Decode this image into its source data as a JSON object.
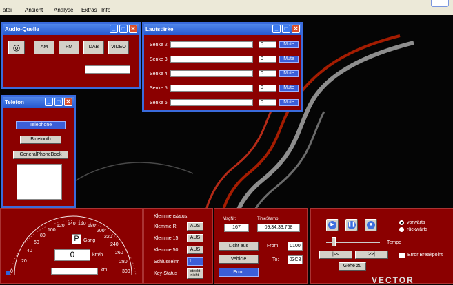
{
  "menu": [
    "atei",
    "Ansicht",
    "Analyse",
    "Extras",
    "Info"
  ],
  "audio_source": {
    "title": "Audio-Quelle",
    "sources": [
      "",
      "AM",
      "FM",
      "DAB",
      "VIDEO"
    ]
  },
  "volume": {
    "title": "Lautstärke",
    "rows": [
      {
        "label": "Senke 2",
        "value": "0",
        "mute": "Mute"
      },
      {
        "label": "Senke 3",
        "value": "0",
        "mute": "Mute"
      },
      {
        "label": "Senke 4",
        "value": "0",
        "mute": "Mute"
      },
      {
        "label": "Senke 5",
        "value": "0",
        "mute": "Mute"
      },
      {
        "label": "Senke 6",
        "value": "0",
        "mute": "Mute"
      }
    ]
  },
  "phone": {
    "title": "Telefon",
    "telephone_btn": "Telephone",
    "bluetooth_btn": "Bluetooth",
    "phonebook_btn": "GeneralPhoneBook"
  },
  "speedometer": {
    "ticks": [
      "20",
      "40",
      "60",
      "80",
      "100",
      "120",
      "140",
      "160",
      "180",
      "200",
      "220",
      "240",
      "260",
      "280",
      "300"
    ],
    "zero": "0",
    "gear": "P",
    "gear_label": "Gang",
    "speed": "0",
    "speed_unit": "km/h",
    "km_unit": "km"
  },
  "klemmen": {
    "title": "Klemmenstatus:",
    "rows": [
      {
        "label": "Klemme R",
        "value": "AUS"
      },
      {
        "label": "Klemme 15",
        "value": "AUS"
      },
      {
        "label": "Klemme 50",
        "value": "AUS"
      },
      {
        "label": "Schlüsselnr.",
        "value": "1"
      },
      {
        "label": "Key-Status",
        "value": "steckt nicht."
      }
    ]
  },
  "message": {
    "msgnr_label": "MsgNr:",
    "msgnr": "167",
    "timestamp_label": "TimeStamp:",
    "timestamp": "09:34:33.768",
    "licht_btn": "Licht aus",
    "from_label": "From:",
    "from": "0100",
    "vehicle_btn": "Vehicle",
    "to_label": "To:",
    "to": "03C8",
    "error_btn": "Error"
  },
  "playback": {
    "forward_label": "vorwärts",
    "backward_label": "rückwärts",
    "tempo_label": "Tempo",
    "prev_btn": "|<<",
    "next_btn": ">>|",
    "breakpoint_label": "Error Breakpoint",
    "goto_btn": "Gehe zu"
  },
  "logo": "VECTOR",
  "colors": {
    "panel": "#8b0000",
    "title_blue": "#2f63d8",
    "button_blue": "#3c5ed8"
  }
}
